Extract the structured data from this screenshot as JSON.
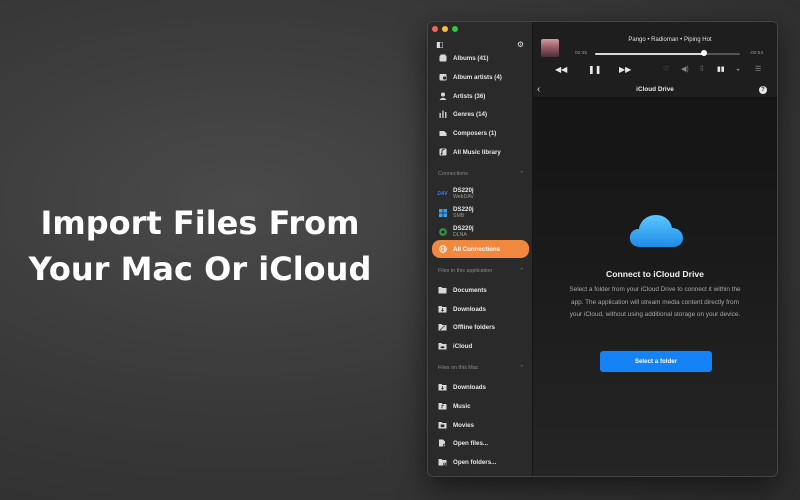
{
  "promo": {
    "line1": "Import Files From",
    "line2": "Your Mac Or iCloud"
  },
  "sidebar": {
    "library_items": [
      {
        "label": "Albums (41)",
        "icon": "album-icon"
      },
      {
        "label": "Album artists (4)",
        "icon": "album-artist-icon"
      },
      {
        "label": "Artists (36)",
        "icon": "artist-icon"
      },
      {
        "label": "Genres (14)",
        "icon": "genres-icon"
      },
      {
        "label": "Composers (1)",
        "icon": "composer-icon"
      },
      {
        "label": "All Music library",
        "icon": "music-library-icon"
      }
    ],
    "connections_header": "Connections",
    "connections": [
      {
        "name": "DS220j",
        "protocol": "WebDAV",
        "icon": "webdav-icon"
      },
      {
        "name": "DS220j",
        "protocol": "SMB",
        "icon": "windows-smb-icon"
      },
      {
        "name": "DS220j",
        "protocol": "DLNA",
        "icon": "dlna-icon"
      }
    ],
    "all_connections": "All Connections",
    "app_files_header": "Files in this application",
    "app_files": [
      {
        "label": "Documents",
        "icon": "documents-folder-icon"
      },
      {
        "label": "Downloads",
        "icon": "downloads-folder-icon"
      },
      {
        "label": "Offline folders",
        "icon": "offline-folder-icon"
      },
      {
        "label": "iCloud",
        "icon": "icloud-folder-icon"
      }
    ],
    "mac_files_header": "Files on this Mac",
    "mac_files": [
      {
        "label": "Downloads",
        "icon": "downloads-folder-icon"
      },
      {
        "label": "Music",
        "icon": "music-folder-icon"
      },
      {
        "label": "Movies",
        "icon": "movies-folder-icon"
      },
      {
        "label": "Open files...",
        "icon": "open-files-icon"
      },
      {
        "label": "Open folders...",
        "icon": "open-folders-icon"
      }
    ]
  },
  "player": {
    "track": "Pango • Radioman • Piping Hot",
    "elapsed": "02:45",
    "remaining": "-00:54",
    "progress": 0.75
  },
  "navbar": {
    "title": "iCloud Drive",
    "help": "?"
  },
  "content": {
    "title": "Connect to iCloud Drive",
    "description": "Select a folder from your iCloud Drive to connect it within the app. The application will stream media content directly from your iCloud, without using additional storage on your device.",
    "button": "Select a folder"
  },
  "colors": {
    "accent": "#f0883e",
    "button": "#1583f5"
  }
}
